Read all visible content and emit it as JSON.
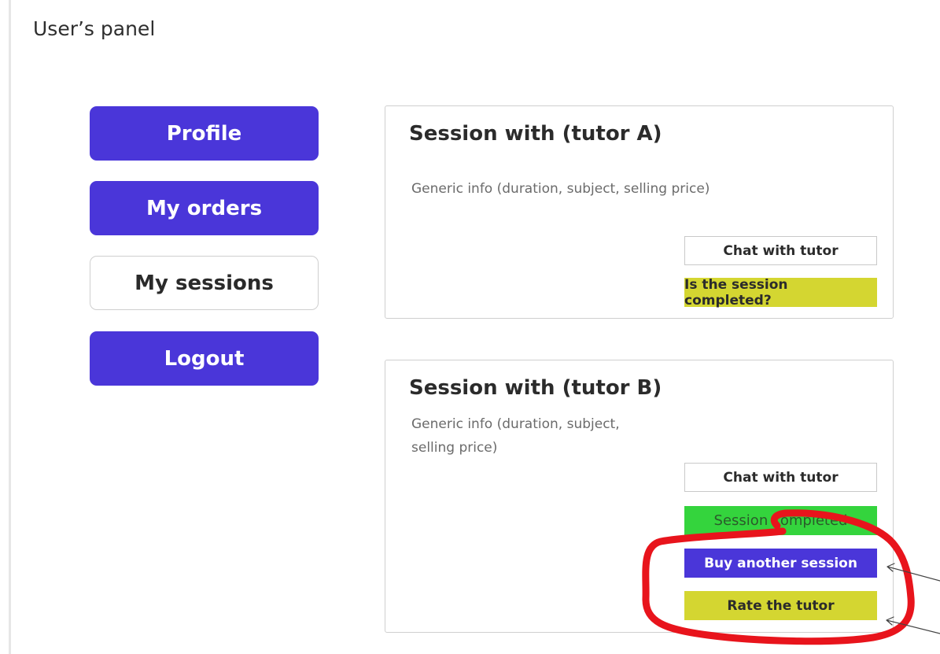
{
  "page": {
    "title": "User’s panel"
  },
  "sidebar": {
    "items": [
      {
        "label": "Profile",
        "style": "primary"
      },
      {
        "label": "My orders",
        "style": "primary"
      },
      {
        "label": "My sessions",
        "style": "outline"
      },
      {
        "label": "Logout",
        "style": "primary"
      }
    ]
  },
  "sessions": [
    {
      "title": "Session with (tutor A)",
      "info": "Generic info (duration, subject, selling price)",
      "chat_label": "Chat with tutor",
      "status_label": "Is the session completed?"
    },
    {
      "title": "Session with (tutor B)",
      "info_line1": "Generic info (duration, subject,",
      "info_line2": "selling price)",
      "chat_label": "Chat with tutor",
      "status_label": "Session completed",
      "buy_label": "Buy another session",
      "rate_label": "Rate the tutor"
    }
  ],
  "colors": {
    "primary": "#4a36d9",
    "yellow": "#d4d631",
    "green": "#34d43d",
    "annotation": "#e8141c"
  }
}
